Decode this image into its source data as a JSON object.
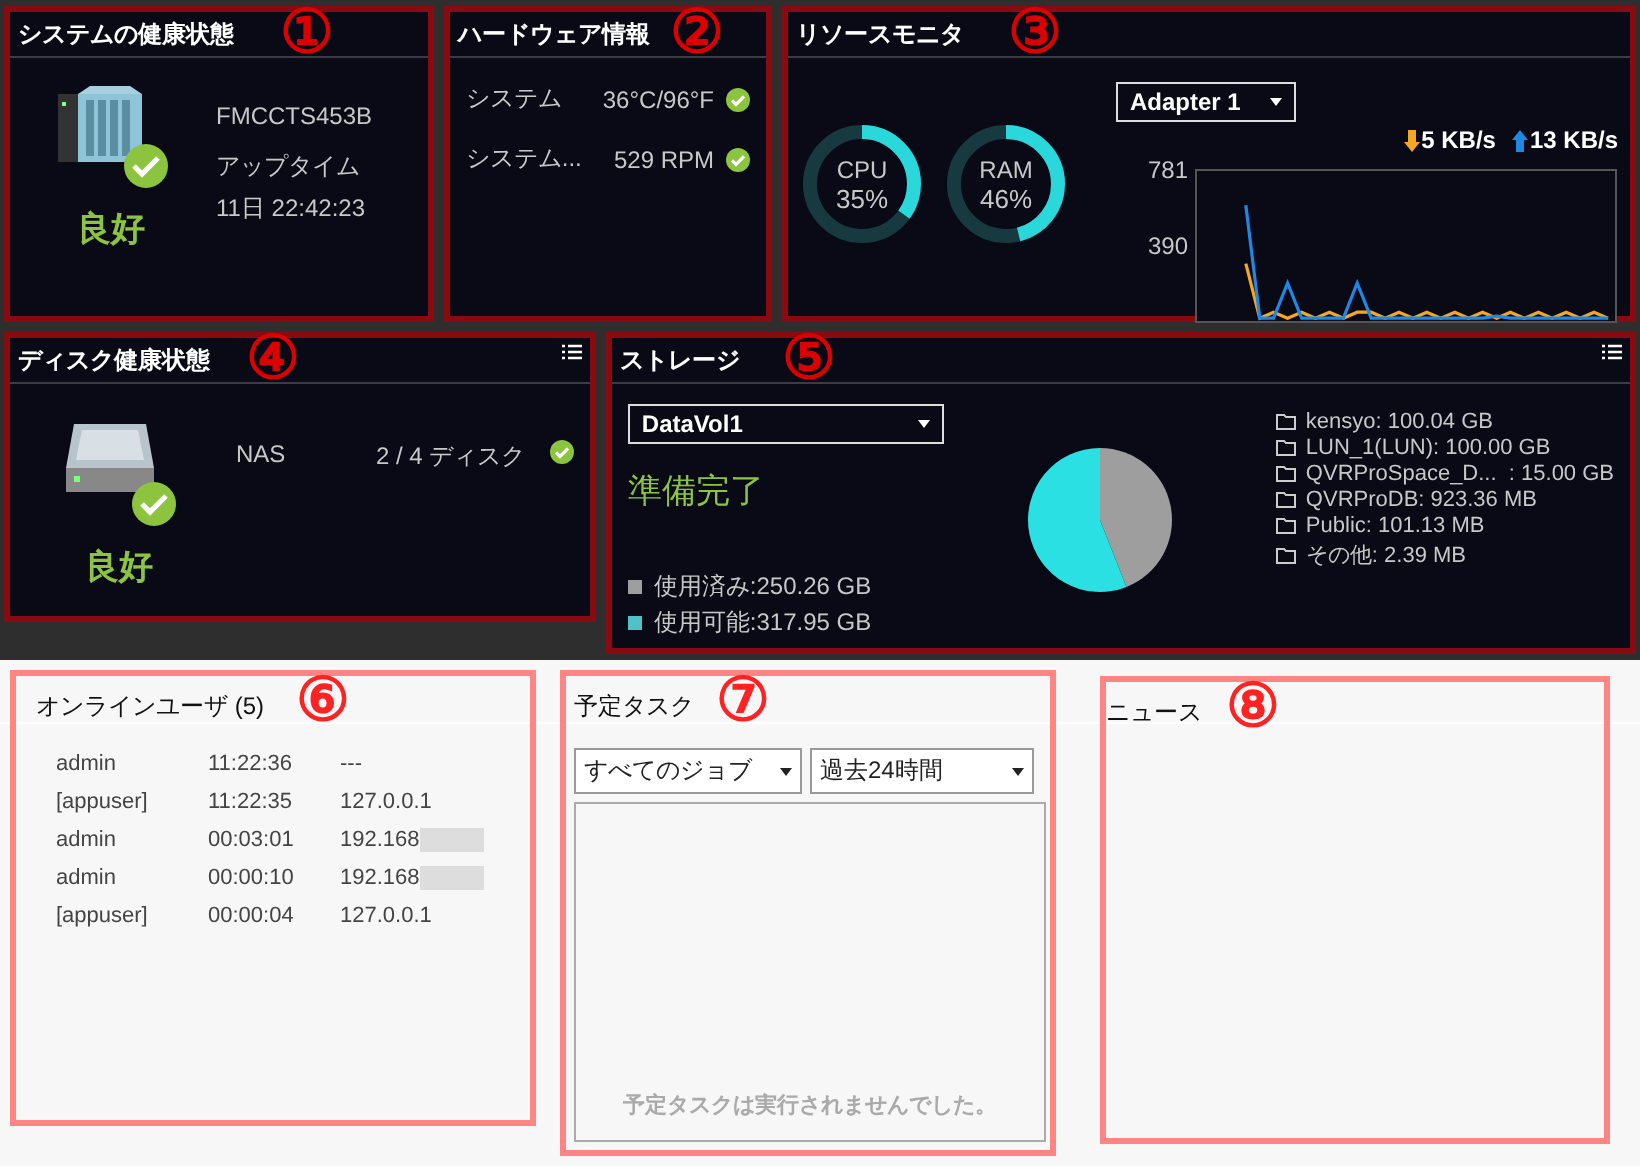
{
  "system_health": {
    "title": "システムの健康状態",
    "mark": "①",
    "device_name": "FMCCTS453B",
    "uptime_label": "アップタイム",
    "uptime": "11日 22:42:23",
    "status": "良好",
    "ok": true
  },
  "hardware": {
    "title": "ハードウェア情報",
    "mark": "②",
    "items": [
      {
        "label": "システム",
        "value": "36°C/96°F",
        "ok": true
      },
      {
        "label": "システム...",
        "value": "529 RPM",
        "ok": true
      }
    ]
  },
  "resource_monitor": {
    "title": "リソースモニタ",
    "mark": "③",
    "cpu": {
      "label": "CPU",
      "reading": "35%",
      "level": 0.35
    },
    "ram": {
      "label": "RAM",
      "reading": "46%",
      "level": 0.46
    },
    "adapter": "Adapter 1",
    "download": "5 KB/s",
    "upload": "13 KB/s",
    "chart_data": {
      "type": "line",
      "ylim": [
        0,
        781
      ],
      "yticks": [
        390,
        781
      ],
      "series": [
        {
          "color": "#f5a623",
          "values": [
            null,
            null,
            null,
            300,
            20,
            50,
            20,
            50,
            20,
            50,
            20,
            50,
            50,
            20,
            50,
            20,
            50,
            20,
            50,
            20,
            50,
            20,
            50,
            20,
            50,
            20,
            50,
            20,
            50,
            20
          ]
        },
        {
          "color": "#1e88e5",
          "values": [
            null,
            null,
            null,
            600,
            20,
            20,
            200,
            20,
            20,
            20,
            20,
            200,
            20,
            20,
            20,
            20,
            20,
            20,
            20,
            20,
            20,
            30,
            20,
            20,
            20,
            20,
            20,
            20,
            20,
            20
          ]
        }
      ]
    }
  },
  "disk_health": {
    "title": "ディスク健康状態",
    "mark": "④",
    "device": "NAS",
    "disks": "2 / 4 ディスク",
    "ok": true,
    "status": "良好"
  },
  "storage": {
    "title": "ストレージ",
    "mark": "⑤",
    "volume": "DataVol1",
    "status": "準備完了",
    "legend": [
      {
        "label": "使用済み:250.26 GB",
        "color": "#9e9e9e"
      },
      {
        "label": "使用可能:317.95 GB",
        "color": "#4fc3c8"
      }
    ],
    "folders": [
      "kensyo: 100.04 GB",
      "LUN_1(LUN): 100.00 GB",
      "QVRProSpace_D...  : 15.00 GB",
      "QVRProDB: 923.36 MB",
      "Public: 101.13 MB",
      "その他: 2.39 MB"
    ],
    "chart_data": {
      "type": "pie",
      "values": [
        44,
        56
      ]
    }
  },
  "online_users": {
    "title": "オンラインユーザ (5)",
    "mark": "⑥",
    "rows": [
      {
        "user": "admin",
        "time": "11:22:36",
        "ip": "---",
        "masked": false
      },
      {
        "user": "[appuser]",
        "time": "11:22:35",
        "ip": "127.0.0.1",
        "masked": false
      },
      {
        "user": "admin",
        "time": "00:03:01",
        "ip": "192.168",
        "masked": true
      },
      {
        "user": "admin",
        "time": "00:00:10",
        "ip": "192.168",
        "masked": true
      },
      {
        "user": "[appuser]",
        "time": "00:00:04",
        "ip": "127.0.0.1",
        "masked": false
      }
    ]
  },
  "scheduled_tasks": {
    "title": "予定タスク",
    "mark": "⑦",
    "job_filter": "すべてのジョブ",
    "period": "過去24時間",
    "empty_message": "予定タスクは実行されませんでした。"
  },
  "news": {
    "title": "ニュース",
    "mark": "⑧"
  }
}
